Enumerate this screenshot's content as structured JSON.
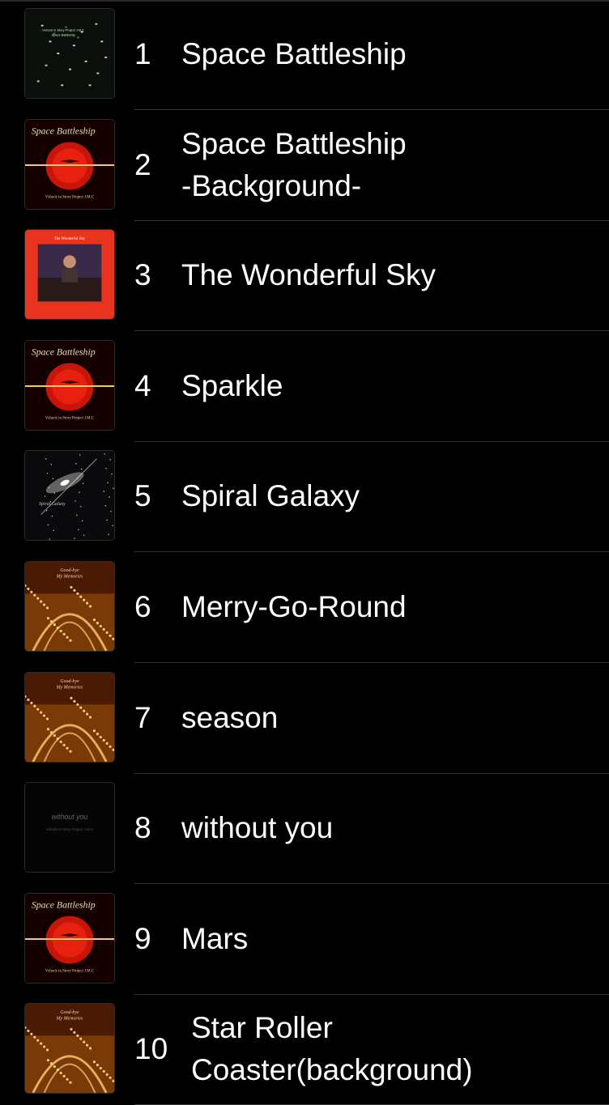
{
  "tracks": [
    {
      "number": "1",
      "title": "Space Battleship",
      "art": "space-night"
    },
    {
      "number": "2",
      "title": "Space Battleship\n-Background-",
      "art": "space-battleship",
      "art_title": "Space Battleship",
      "art_credit": "Vshock in Story Project J.M.C"
    },
    {
      "number": "3",
      "title": "The Wonderful Sky",
      "art": "wonderful-sky",
      "art_title": "The Wonderful Sky"
    },
    {
      "number": "4",
      "title": "Sparkle",
      "art": "space-battleship",
      "art_title": "Space Battleship",
      "art_credit": "Vshock in Story Project J.M.C"
    },
    {
      "number": "5",
      "title": "Spiral Galaxy",
      "art": "spiral-galaxy",
      "art_title": "Spiral Galaxy"
    },
    {
      "number": "6",
      "title": "Merry-Go-Round",
      "art": "goodbye-memories",
      "art_title": "Good-bye My Memories"
    },
    {
      "number": "7",
      "title": "season",
      "art": "goodbye-memories",
      "art_title": "Good-bye My Memories"
    },
    {
      "number": "8",
      "title": "without you",
      "art": "without-you",
      "art_title": "without you",
      "art_credit": "Vshock in Story Project J.M.C"
    },
    {
      "number": "9",
      "title": "Mars",
      "art": "space-battleship",
      "art_title": "Space Battleship",
      "art_credit": "Vshock in Story Project J.M.C"
    },
    {
      "number": "10",
      "title": "Star Roller\nCoaster(background)",
      "art": "goodbye-memories",
      "art_title": "Good-bye My Memories"
    }
  ],
  "colors": {
    "background": "#000000",
    "text": "#ffffff",
    "divider": "#333333"
  }
}
